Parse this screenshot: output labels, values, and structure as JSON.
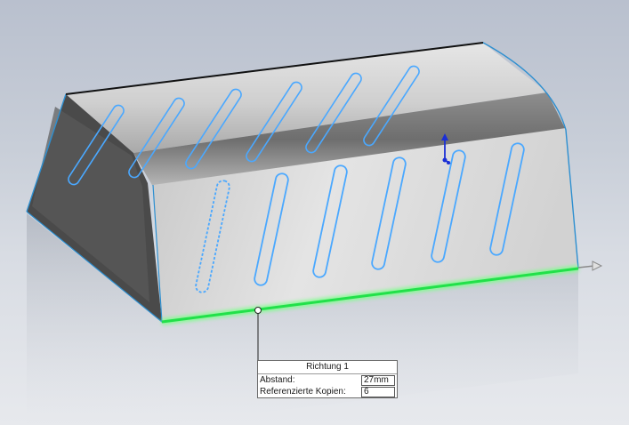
{
  "callout": {
    "title": "Richtung 1",
    "spacing_label": "Abstand:",
    "spacing_value": "27mm",
    "copies_label": "Referenzierte Kopien:",
    "copies_value": "6"
  },
  "colors": {
    "edge_selection": "#22e04a",
    "slot_outline": "#4aa8ff",
    "triad_axis": "#1a2fd6"
  }
}
